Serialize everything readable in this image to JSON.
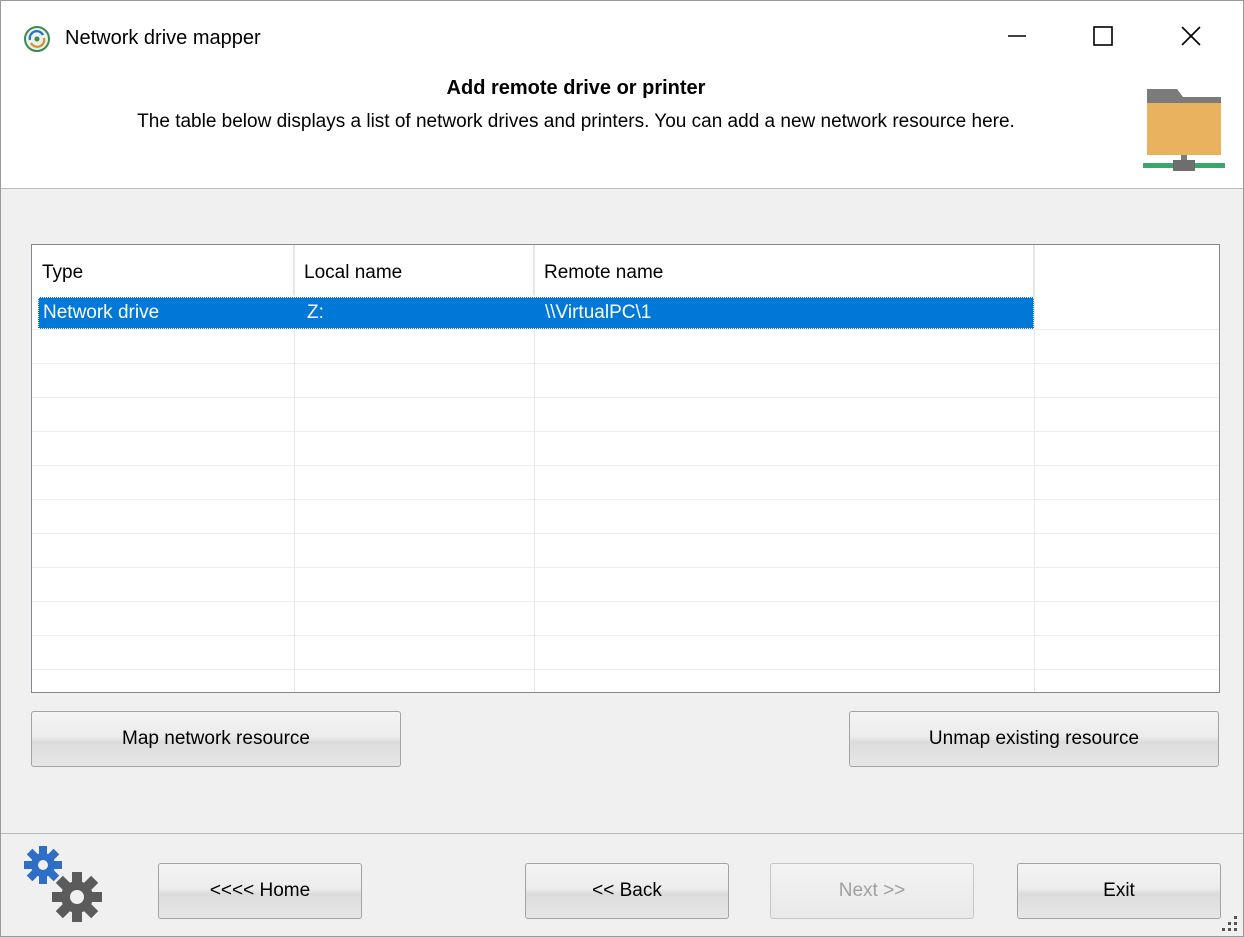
{
  "window": {
    "title": "Network drive mapper",
    "icons": {
      "app": "app-network-icon",
      "minimize": "minimize-icon",
      "maximize": "maximize-icon",
      "close": "close-icon"
    }
  },
  "header": {
    "title": "Add remote drive or printer",
    "description": "The table below displays a list of network drives and printers. You can add a new network resource here.",
    "icon": "network-folder-icon"
  },
  "grid": {
    "columns": [
      "Type",
      "Local name",
      "Remote name"
    ],
    "rows": [
      {
        "type": "Network drive",
        "local_name": "Z:",
        "remote_name": "\\\\VirtualPC\\1",
        "selected": true
      }
    ]
  },
  "actions": {
    "map": "Map network resource",
    "unmap": "Unmap existing resource"
  },
  "nav": {
    "home": "<<<< Home",
    "back": "<< Back",
    "next": "Next >>",
    "exit": "Exit",
    "next_enabled": false
  },
  "colors": {
    "selection": "#0078d7",
    "folder": "#e9b25e",
    "network": "#3aa66b",
    "gear": "#2f6ec6"
  }
}
